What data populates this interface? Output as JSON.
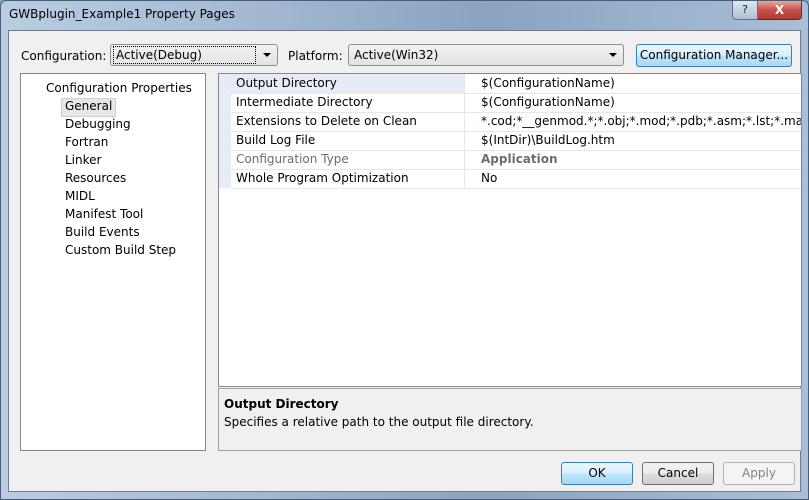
{
  "window": {
    "title": "GWBplugin_Example1 Property Pages",
    "help_label": "?",
    "close_label": "X"
  },
  "toolbar": {
    "configuration_label": "Configuration:",
    "configuration_value": "Active(Debug)",
    "platform_label": "Platform:",
    "platform_value": "Active(Win32)",
    "config_manager_label": "Configuration Manager..."
  },
  "tree": {
    "root": "Configuration Properties",
    "items": [
      {
        "label": "General",
        "selected": true
      },
      {
        "label": "Debugging"
      },
      {
        "label": "Fortran"
      },
      {
        "label": "Linker"
      },
      {
        "label": "Resources"
      },
      {
        "label": "MIDL"
      },
      {
        "label": "Manifest Tool"
      },
      {
        "label": "Build Events"
      },
      {
        "label": "Custom Build Step"
      }
    ]
  },
  "properties": [
    {
      "name": "Output Directory",
      "value": "$(ConfigurationName)",
      "selected": true
    },
    {
      "name": "Intermediate Directory",
      "value": "$(ConfigurationName)"
    },
    {
      "name": "Extensions to Delete on Clean",
      "value": "*.cod;*__genmod.*;*.obj;*.mod;*.pdb;*.asm;*.lst;*.map;*.dyn;*"
    },
    {
      "name": "Build Log File",
      "value": "$(IntDir)\\BuildLog.htm"
    },
    {
      "name": "Configuration Type",
      "value": "Application",
      "disabled": true
    },
    {
      "name": "Whole Program Optimization",
      "value": "No"
    }
  ],
  "description": {
    "title": "Output Directory",
    "text": "Specifies a relative path to the output file directory."
  },
  "buttons": {
    "ok": "OK",
    "cancel": "Cancel",
    "apply": "Apply"
  }
}
